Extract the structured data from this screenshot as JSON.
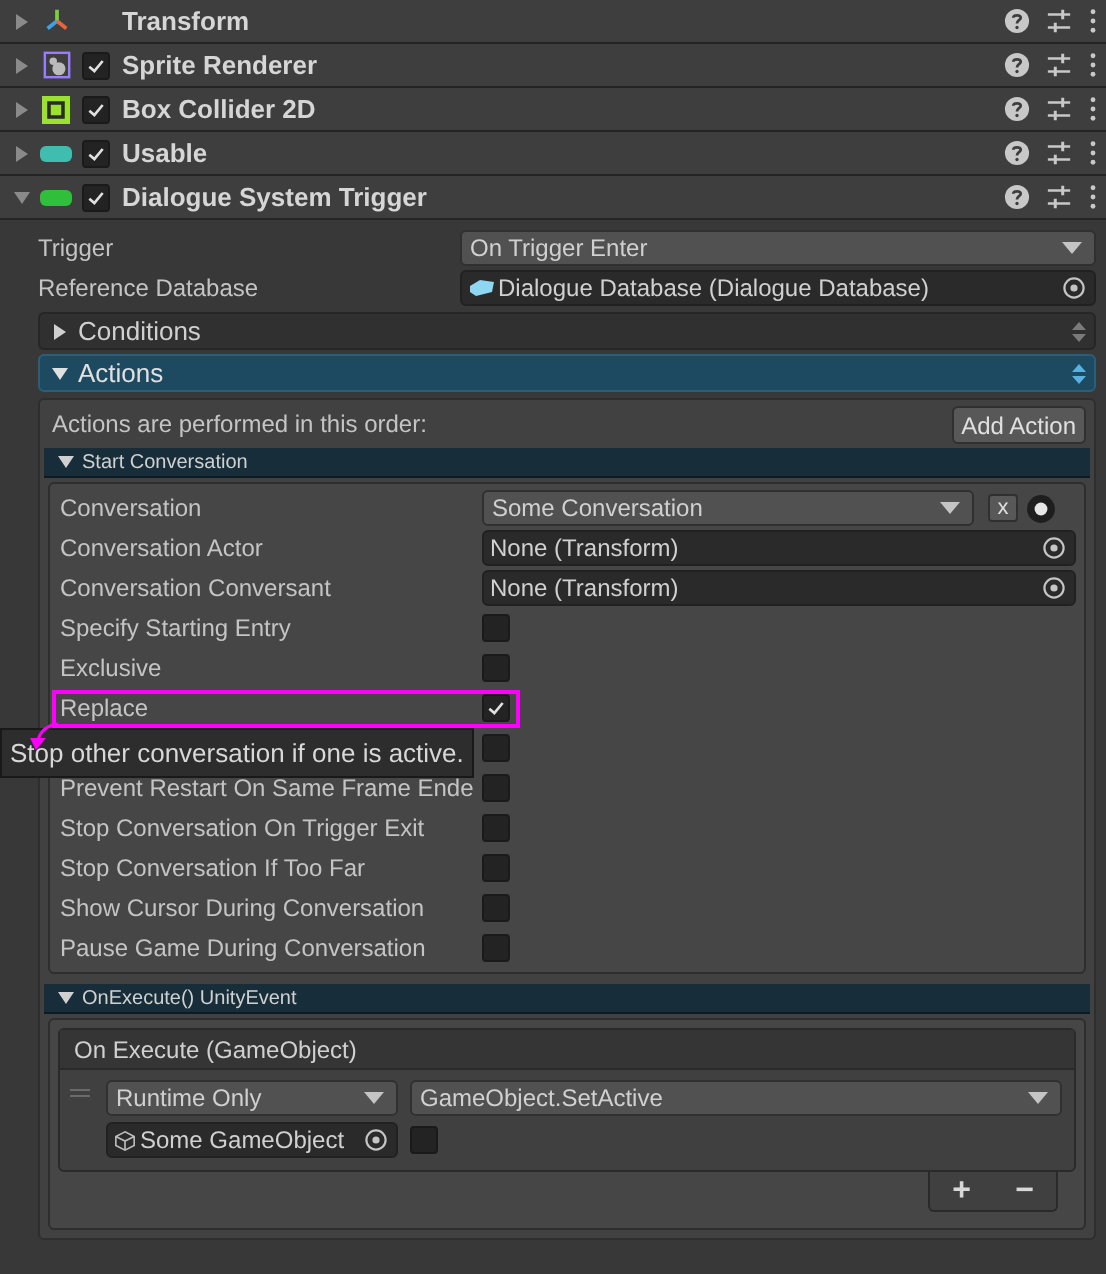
{
  "components": [
    {
      "kind": "transform",
      "name": "Transform",
      "expanded": false
    },
    {
      "kind": "sprite",
      "name": "Sprite Renderer",
      "expanded": false,
      "enabled": true
    },
    {
      "kind": "collider",
      "name": "Box Collider 2D",
      "expanded": false,
      "enabled": true
    },
    {
      "kind": "usable",
      "name": "Usable",
      "expanded": false,
      "enabled": true
    },
    {
      "kind": "trigger",
      "name": "Dialogue System Trigger",
      "expanded": true,
      "enabled": true
    }
  ],
  "properties": [
    {
      "kind": "dropdown",
      "label": "Trigger",
      "value": "On Trigger Enter"
    },
    {
      "kind": "object",
      "label": "Reference Database",
      "value": "Dialogue Database (Dialogue Database)"
    }
  ],
  "foldouts": [
    {
      "label": "Conditions",
      "expanded": false
    },
    {
      "label": "Actions",
      "expanded": true
    }
  ],
  "actions": {
    "note": "Actions are performed in this order:",
    "add_button": "Add Action",
    "start_conversation": {
      "title": "Start Conversation",
      "expanded": true,
      "rows": [
        {
          "kind": "conversation",
          "label": "Conversation",
          "value": "Some Conversation",
          "clear": "x"
        },
        {
          "kind": "object",
          "label": "Conversation Actor",
          "value": "None (Transform)"
        },
        {
          "kind": "object",
          "label": "Conversation Conversant",
          "value": "None (Transform)"
        },
        {
          "kind": "checkbox",
          "label": "Specify Starting Entry",
          "checked": false
        },
        {
          "kind": "checkbox",
          "label": "Exclusive",
          "checked": false
        },
        {
          "kind": "checkbox",
          "label": "Replace",
          "checked": true,
          "highlighted": true
        },
        {
          "kind": "checkbox",
          "checked": false
        },
        {
          "kind": "checkbox",
          "label": "Prevent Restart On Same Frame Ende",
          "checked": false
        },
        {
          "kind": "checkbox",
          "label": "Stop Conversation On Trigger Exit",
          "checked": false
        },
        {
          "kind": "checkbox",
          "label": "Stop Conversation If Too Far",
          "checked": false
        },
        {
          "kind": "checkbox",
          "label": "Show Cursor During Conversation",
          "checked": false
        },
        {
          "kind": "checkbox",
          "label": "Pause Game During Conversation",
          "checked": false
        }
      ]
    },
    "unity_event": {
      "title": "OnExecute() UnityEvent",
      "expanded": true,
      "header": "On Execute (GameObject)",
      "mode": "Runtime Only",
      "function": "GameObject.SetActive",
      "target": "Some GameObject",
      "argument_checked": false,
      "buttons": [
        "+",
        "−"
      ]
    }
  },
  "tooltip": "Stop other conversation if one is active."
}
